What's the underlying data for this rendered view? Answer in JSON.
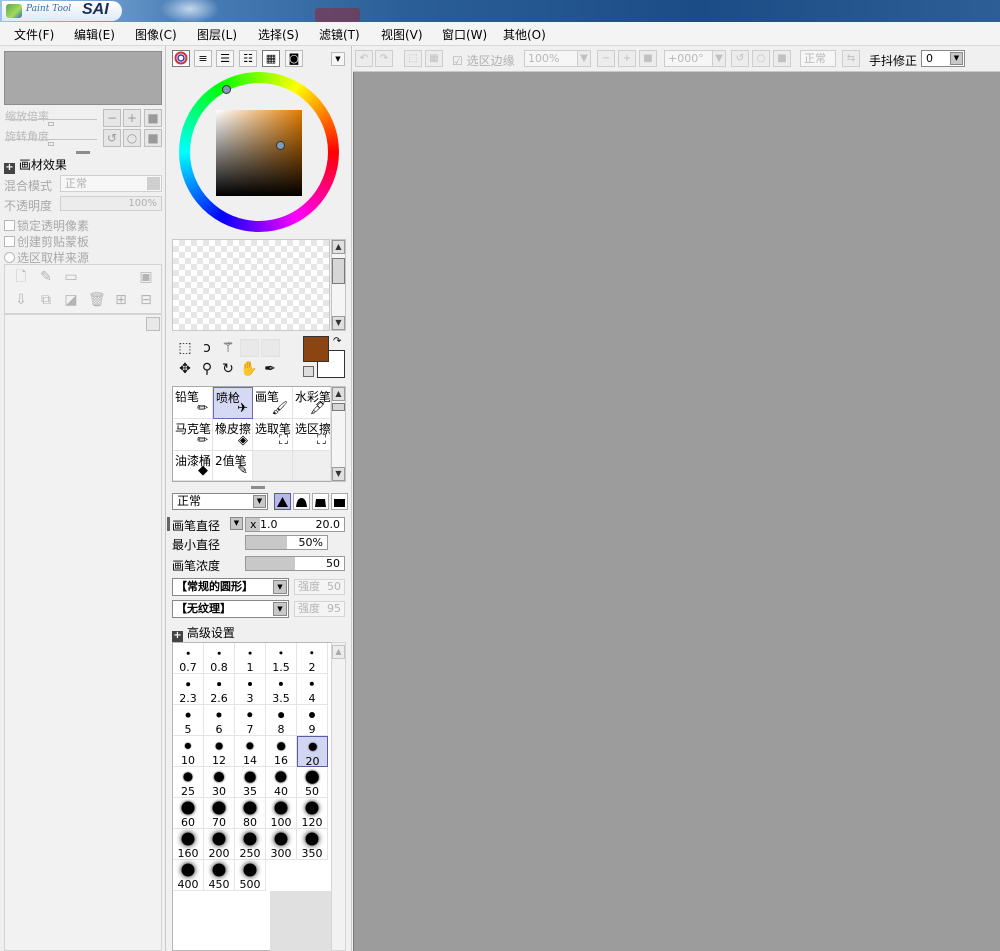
{
  "app": {
    "title_small": "Paint Tool",
    "title_big": "SAI"
  },
  "menu": {
    "items": [
      "文件(F)",
      "编辑(E)",
      "图像(C)",
      "图层(L)",
      "选择(S)",
      "滤镜(T)",
      "视图(V)",
      "窗口(W)",
      "其他(O)"
    ]
  },
  "navigator": {
    "zoom_label": "缩放倍率",
    "rotate_label": "旋转角度"
  },
  "layer_props": {
    "section_title": "画材效果",
    "blend_label": "混合模式",
    "blend_value": "正常",
    "opacity_label": "不透明度",
    "opacity_value": "100%",
    "lock_alpha": "锁定透明像素",
    "clip_mask": "创建剪贴蒙板",
    "selection_source": "选区取样来源"
  },
  "colors": {
    "foreground": "#8b4513",
    "background": "#ffffff"
  },
  "brushes": [
    {
      "name": "铅笔",
      "icon": "pencil-icon"
    },
    {
      "name": "喷枪",
      "icon": "airbrush-icon",
      "selected": true
    },
    {
      "name": "画笔",
      "icon": "brush-icon"
    },
    {
      "name": "水彩笔",
      "icon": "watercolor-icon"
    },
    {
      "name": "马克笔",
      "icon": "marker-icon"
    },
    {
      "name": "橡皮擦",
      "icon": "eraser-icon"
    },
    {
      "name": "选取笔",
      "icon": "select-pen-icon"
    },
    {
      "name": "选区擦",
      "icon": "select-eraser-icon"
    },
    {
      "name": "油漆桶",
      "icon": "bucket-icon"
    },
    {
      "name": "2值笔",
      "icon": "binary-pen-icon"
    }
  ],
  "brush_settings": {
    "mode": "正常",
    "size_label": "画笔直径",
    "size_multiplier": "x 1.0",
    "size_value": "20.0",
    "min_size_label": "最小直径",
    "min_size_value": "50%",
    "min_size_fraction": 0.5,
    "density_label": "画笔浓度",
    "density_value": "50",
    "density_fraction": 0.5,
    "shape_combo": "【常规的圆形】",
    "shape_strength_label": "强度",
    "shape_strength_value": "50",
    "texture_combo": "【无纹理】",
    "texture_strength_label": "强度",
    "texture_strength_value": "95",
    "advanced_label": "高级设置"
  },
  "brush_sizes": [
    "0.7",
    "0.8",
    "1",
    "1.5",
    "2",
    "2.3",
    "2.6",
    "3",
    "3.5",
    "4",
    "5",
    "6",
    "7",
    "8",
    "9",
    "10",
    "12",
    "14",
    "16",
    "20",
    "25",
    "30",
    "35",
    "40",
    "50",
    "60",
    "70",
    "80",
    "100",
    "120",
    "160",
    "200",
    "250",
    "300",
    "350",
    "400",
    "450",
    "500"
  ],
  "selected_size": "20",
  "toolbar": {
    "selection_edge_label": "选区边缘",
    "zoom_value": "100%",
    "angle_value": "+000°",
    "blend_value": "正常",
    "stabilizer_label": "手抖修正",
    "stabilizer_value": "0"
  }
}
